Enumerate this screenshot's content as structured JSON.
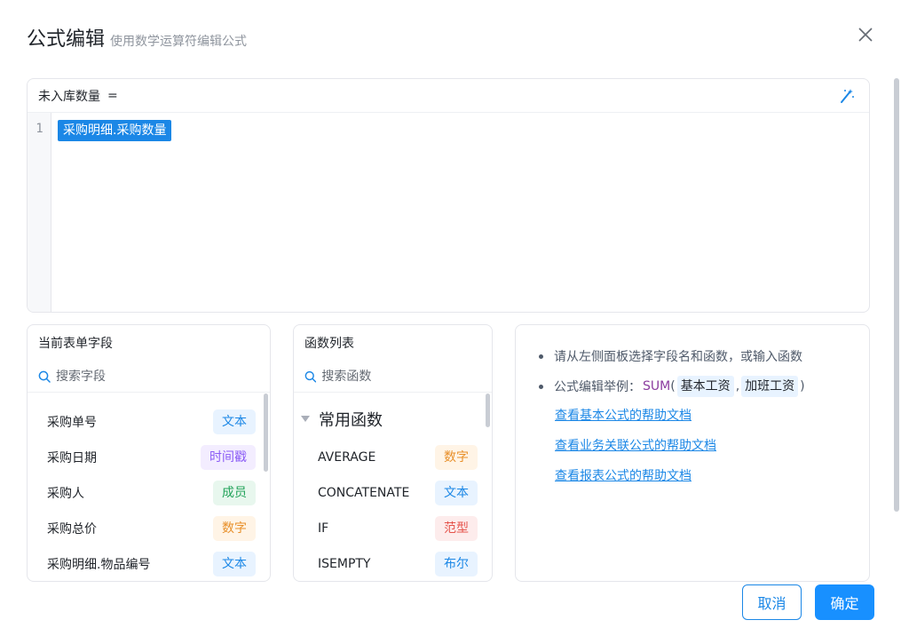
{
  "dialog": {
    "title": "公式编辑",
    "subtitle": "使用数学运算符编辑公式"
  },
  "editor": {
    "target_field": "未入库数量",
    "equals": "=",
    "line_number": "1",
    "formula_token": "采购明细.采购数量"
  },
  "fields_panel": {
    "title": "当前表单字段",
    "search_placeholder": "搜索字段",
    "items": [
      {
        "label": "采购单号",
        "tag": "文本",
        "tag_color": "blue"
      },
      {
        "label": "采购日期",
        "tag": "时间戳",
        "tag_color": "purple"
      },
      {
        "label": "采购人",
        "tag": "成员",
        "tag_color": "green"
      },
      {
        "label": "采购总价",
        "tag": "数字",
        "tag_color": "orange"
      },
      {
        "label": "采购明细.物品编号",
        "tag": "文本",
        "tag_color": "blue"
      }
    ]
  },
  "functions_panel": {
    "title": "函数列表",
    "search_placeholder": "搜索函数",
    "group_label": "常用函数",
    "items": [
      {
        "label": "AVERAGE",
        "tag": "数字",
        "tag_color": "orange"
      },
      {
        "label": "CONCATENATE",
        "tag": "文本",
        "tag_color": "blue"
      },
      {
        "label": "IF",
        "tag": "范型",
        "tag_color": "red"
      },
      {
        "label": "ISEMPTY",
        "tag": "布尔",
        "tag_color": "blue"
      }
    ]
  },
  "help_panel": {
    "hint": "请从左侧面板选择字段名和函数，或输入函数",
    "example_prefix": "公式编辑举例：",
    "example_fn": "SUM",
    "example_open": "(",
    "example_arg1": "基本工资",
    "example_sep": ",",
    "example_arg2": "加班工资",
    "example_close": ")",
    "links": [
      "查看基本公式的帮助文档",
      "查看业务关联公式的帮助文档",
      "查看报表公式的帮助文档"
    ]
  },
  "footer": {
    "cancel_label": "取消",
    "ok_label": "确定"
  },
  "colors": {
    "accent": "#1890ff",
    "chip": "#1b87e6",
    "function_name": "#8b3c9f"
  },
  "icons": {
    "close": "close-icon",
    "magic": "magic-wand-icon",
    "search": "search-icon",
    "collapse": "caret-down-icon"
  }
}
